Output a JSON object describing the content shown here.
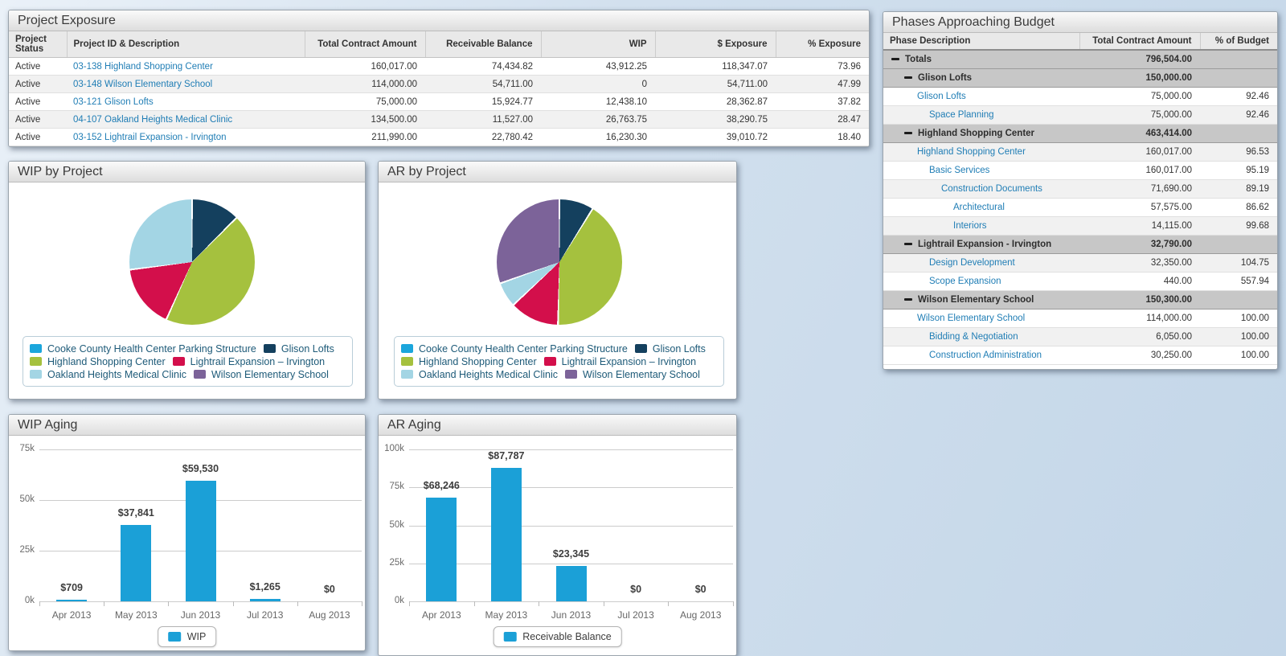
{
  "project_exposure": {
    "title": "Project Exposure",
    "headers": [
      "Project Status",
      "Project ID & Description",
      "Total Contract Amount",
      "Receivable Balance",
      "WIP",
      "$ Exposure",
      "% Exposure"
    ],
    "rows": [
      [
        "Active",
        "03-138 Highland Shopping Center",
        "160,017.00",
        "74,434.82",
        "43,912.25",
        "118,347.07",
        "73.96"
      ],
      [
        "Active",
        "03-148 Wilson Elementary School",
        "114,000.00",
        "54,711.00",
        "0",
        "54,711.00",
        "47.99"
      ],
      [
        "Active",
        "03-121 Glison Lofts",
        "75,000.00",
        "15,924.77",
        "12,438.10",
        "28,362.87",
        "37.82"
      ],
      [
        "Active",
        "04-107 Oakland Heights Medical Clinic",
        "134,500.00",
        "11,527.00",
        "26,763.75",
        "38,290.75",
        "28.47"
      ],
      [
        "Active",
        "03-152 Lightrail Expansion - Irvington",
        "211,990.00",
        "22,780.42",
        "16,230.30",
        "39,010.72",
        "18.40"
      ]
    ]
  },
  "phases_budget": {
    "title": "Phases Approaching Budget",
    "headers": [
      "Phase Description",
      "Total Contract Amount",
      "% of Budget"
    ],
    "rows": [
      {
        "label": "Totals",
        "amount": "796,504.00",
        "pct": "",
        "type": "total",
        "indent": 0
      },
      {
        "label": "Glison Lofts",
        "amount": "150,000.00",
        "pct": "",
        "type": "group",
        "indent": 1
      },
      {
        "label": "Glison Lofts",
        "amount": "75,000.00",
        "pct": "92.46",
        "type": "link",
        "indent": 2
      },
      {
        "label": "Space Planning",
        "amount": "75,000.00",
        "pct": "92.46",
        "type": "link",
        "indent": 3
      },
      {
        "label": "Highland Shopping Center",
        "amount": "463,414.00",
        "pct": "",
        "type": "group",
        "indent": 1
      },
      {
        "label": "Highland Shopping Center",
        "amount": "160,017.00",
        "pct": "96.53",
        "type": "link",
        "indent": 2
      },
      {
        "label": "Basic Services",
        "amount": "160,017.00",
        "pct": "95.19",
        "type": "link",
        "indent": 3
      },
      {
        "label": "Construction Documents",
        "amount": "71,690.00",
        "pct": "89.19",
        "type": "link",
        "indent": 4
      },
      {
        "label": "Architectural",
        "amount": "57,575.00",
        "pct": "86.62",
        "type": "link",
        "indent": 5
      },
      {
        "label": "Interiors",
        "amount": "14,115.00",
        "pct": "99.68",
        "type": "link",
        "indent": 5
      },
      {
        "label": "Lightrail Expansion - Irvington",
        "amount": "32,790.00",
        "pct": "",
        "type": "group",
        "indent": 1
      },
      {
        "label": "Design Development",
        "amount": "32,350.00",
        "pct": "104.75",
        "type": "link",
        "indent": 3
      },
      {
        "label": "Scope Expansion",
        "amount": "440.00",
        "pct": "557.94",
        "type": "link",
        "indent": 3
      },
      {
        "label": "Wilson Elementary School",
        "amount": "150,300.00",
        "pct": "",
        "type": "group",
        "indent": 1
      },
      {
        "label": "Wilson Elementary School",
        "amount": "114,000.00",
        "pct": "100.00",
        "type": "link",
        "indent": 2
      },
      {
        "label": "Bidding & Negotiation",
        "amount": "6,050.00",
        "pct": "100.00",
        "type": "link",
        "indent": 3
      },
      {
        "label": "Construction Administration",
        "amount": "30,250.00",
        "pct": "100.00",
        "type": "link",
        "indent": 3
      }
    ]
  },
  "chart_data": [
    {
      "type": "pie",
      "title": "WIP by Project",
      "legend_position": "bottom",
      "series": [
        {
          "name": "Cooke County Health Center Parking Structure",
          "value": 0,
          "color": "#1ba6dc"
        },
        {
          "name": "Glison Lofts",
          "value": 12438.1,
          "color": "#14405e"
        },
        {
          "name": "Highland Shopping Center",
          "value": 43912.25,
          "color": "#a5c13e"
        },
        {
          "name": "Lightrail Expansion – Irvington",
          "value": 16230.3,
          "color": "#d30f4b"
        },
        {
          "name": "Oakland Heights Medical Clinic",
          "value": 26763.75,
          "color": "#a3d5e4"
        },
        {
          "name": "Wilson Elementary School",
          "value": 0,
          "color": "#7c6399"
        }
      ]
    },
    {
      "type": "pie",
      "title": "AR by Project",
      "legend_position": "bottom",
      "series": [
        {
          "name": "Cooke County Health Center Parking Structure",
          "value": 0,
          "color": "#1ba6dc"
        },
        {
          "name": "Glison Lofts",
          "value": 15924.77,
          "color": "#14405e"
        },
        {
          "name": "Highland Shopping Center",
          "value": 74434.82,
          "color": "#a5c13e"
        },
        {
          "name": "Lightrail Expansion – Irvington",
          "value": 22780.42,
          "color": "#d30f4b"
        },
        {
          "name": "Oakland Heights Medical Clinic",
          "value": 11527.0,
          "color": "#a3d5e4"
        },
        {
          "name": "Wilson Elementary School",
          "value": 54711.0,
          "color": "#7c6399"
        }
      ]
    },
    {
      "type": "bar",
      "title": "WIP Aging",
      "categories": [
        "Apr 2013",
        "May 2013",
        "Jun 2013",
        "Jul 2013",
        "Aug 2013"
      ],
      "values": [
        709,
        37841,
        59530,
        1265,
        0
      ],
      "labels": [
        "$709",
        "$37,841",
        "$59,530",
        "$1,265",
        "$0"
      ],
      "ylim": [
        0,
        75000
      ],
      "yticks": [
        {
          "v": 0,
          "label": "0k"
        },
        {
          "v": 25000,
          "label": "25k"
        },
        {
          "v": 50000,
          "label": "50k"
        },
        {
          "v": 75000,
          "label": "75k"
        }
      ],
      "legend": "WIP",
      "bar_color": "#1ba0d7",
      "grid": true
    },
    {
      "type": "bar",
      "title": "AR Aging",
      "categories": [
        "Apr 2013",
        "May 2013",
        "Jun 2013",
        "Jul 2013",
        "Aug 2013"
      ],
      "values": [
        68246,
        87787,
        23345,
        0,
        0
      ],
      "labels": [
        "$68,246",
        "$87,787",
        "$23,345",
        "$0",
        "$0"
      ],
      "ylim": [
        0,
        100000
      ],
      "yticks": [
        {
          "v": 0,
          "label": "0k"
        },
        {
          "v": 25000,
          "label": "25k"
        },
        {
          "v": 50000,
          "label": "50k"
        },
        {
          "v": 75000,
          "label": "75k"
        },
        {
          "v": 100000,
          "label": "100k"
        }
      ],
      "legend": "Receivable Balance",
      "bar_color": "#1ba0d7",
      "grid": true
    }
  ]
}
